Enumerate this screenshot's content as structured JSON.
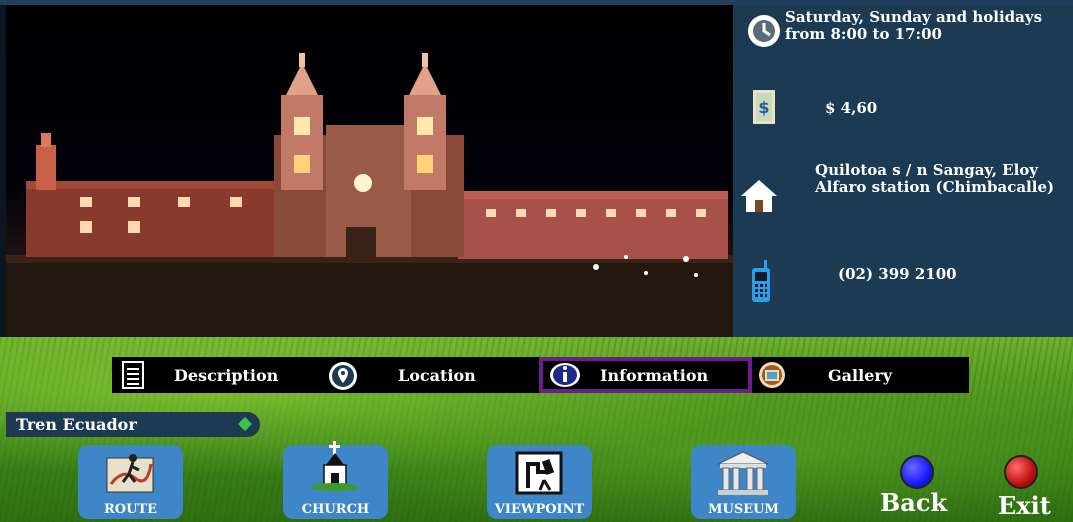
{
  "info": {
    "schedule": "Saturday, Sunday and holidays from 8:00 to 17:00",
    "price": "$ 4,60",
    "address": "Quilotoa s / n Sangay, Eloy Alfaro station (Chimbacalle)",
    "phone": "(02) 399 2100"
  },
  "tabs": {
    "description": "Description",
    "location": "Location",
    "information": "Information",
    "gallery": "Gallery",
    "active": "Information"
  },
  "section_label": "Tren Ecuador",
  "categories": {
    "route": "ROUTE",
    "church": "CHURCH",
    "viewpoint": "VIEWPOINT",
    "museum": "MUSEUM"
  },
  "nav": {
    "back": "Back",
    "exit": "Exit"
  },
  "colors": {
    "panel": "#1c3a52",
    "tab_active_border": "#6a1f8a",
    "category_button": "#3e86c7",
    "back_button": "#1a1aff",
    "exit_button": "#c01010"
  }
}
